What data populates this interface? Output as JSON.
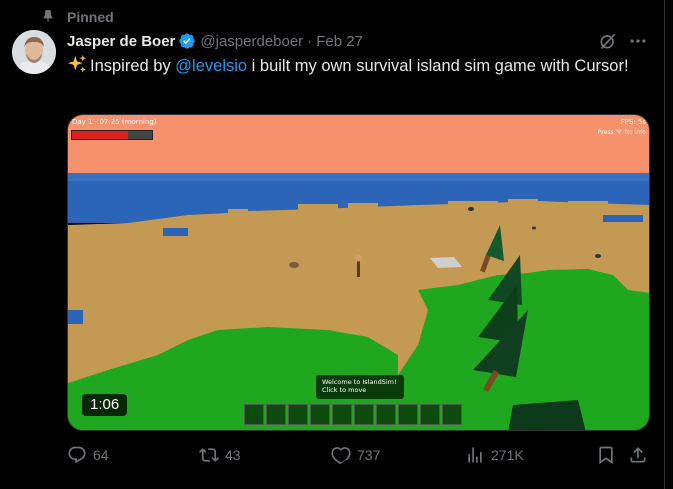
{
  "pinned_label": "Pinned",
  "author": {
    "name": "Jasper de Boer",
    "handle": "@jasperdeboer",
    "date": "Feb 27",
    "verified_color": "#1d9bf0"
  },
  "tweet": {
    "emoji_icon": "sparkles-icon",
    "text_before": "Inspired by ",
    "mention": "@levelsio",
    "text_after": " i built my own survival island sim game with Cursor!"
  },
  "media": {
    "duration": "1:06",
    "hud": {
      "day_label": "Day 1 - 07:25 (morning)",
      "health_fraction": 0.7,
      "fps_label": "FPS: 5s",
      "press_hint": "Press \"i\" for info"
    },
    "welcome_line1": "Welcome to IslandSim!",
    "welcome_line2": "Click to move",
    "hotbar_slots": 10
  },
  "actions": {
    "replies": "64",
    "reposts": "43",
    "likes": "737",
    "views": "271K"
  },
  "colors": {
    "background": "#000000",
    "text": "#e7e9ea",
    "muted": "#71767b",
    "link": "#1d9bf0",
    "sky": "#f5926d",
    "water": "#2c64b8",
    "sand": "#c49954",
    "grass": "#1fa81f"
  }
}
